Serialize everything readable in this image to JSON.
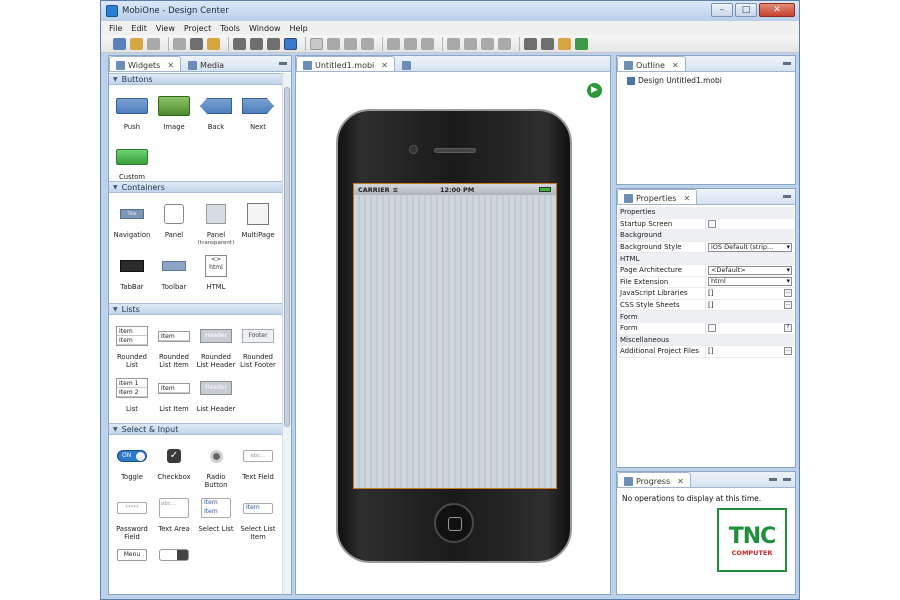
{
  "window": {
    "title": "MobiOne - Design Center",
    "minimize": "–",
    "maximize": "□",
    "close": "✕"
  },
  "menu": [
    "File",
    "Edit",
    "View",
    "Project",
    "Tools",
    "Window",
    "Help"
  ],
  "left_tabs": {
    "widgets": "Widgets",
    "media": "Media"
  },
  "sections": {
    "buttons": {
      "title": "Buttons",
      "items": [
        "Push",
        "Image",
        "Back",
        "Next",
        "Custom"
      ]
    },
    "containers": {
      "title": "Containers",
      "items": [
        "Navigation",
        "Panel",
        "Panel",
        "(transparent)",
        "MultiPage",
        "TabBar",
        "Toolbar",
        "HTML"
      ]
    },
    "lists": {
      "title": "Lists",
      "items": [
        "Rounded List",
        "Rounded List Item",
        "Rounded List Header",
        "Rounded List Footer",
        "List",
        "List Item",
        "List Header"
      ]
    },
    "select_input": {
      "title": "Select & Input",
      "items": [
        "Toggle",
        "Checkbox",
        "Radio Button",
        "Text Field",
        "Password Field",
        "Text Area",
        "Select List",
        "Select List Item"
      ]
    }
  },
  "widget_glyphs": {
    "nav_title": "Title",
    "html_tag": "<>",
    "html_word": "html",
    "item": "Item",
    "item1": "Item 1",
    "item2": "Item 2",
    "header": "Header",
    "footer": "Footer",
    "toggle_on": "ON",
    "check": "✓",
    "abc": "abc...",
    "password": "*****",
    "menu": "Menu"
  },
  "editor": {
    "tab": "Untitled1.mobi",
    "status": {
      "carrier": "CARRIER",
      "time": "12:00 PM"
    }
  },
  "outline": {
    "tab": "Outline",
    "item": "Design Untitled1.mobi"
  },
  "properties": {
    "tab": "Properties",
    "rows": [
      {
        "cat": "Properties"
      },
      {
        "k": "Startup Screen",
        "type": "check"
      },
      {
        "cat": "Background"
      },
      {
        "k": "Background Style",
        "type": "dd",
        "v": "iOS Default (strip..."
      },
      {
        "cat": "HTML"
      },
      {
        "k": "Page Architecture",
        "type": "dd",
        "v": "<Default>"
      },
      {
        "k": "File Extension",
        "type": "dd",
        "v": "html"
      },
      {
        "k": "JavaScript Libraries",
        "type": "list",
        "v": "[]"
      },
      {
        "k": "CSS Style Sheets",
        "type": "list",
        "v": "[]"
      },
      {
        "cat": "Form"
      },
      {
        "k": "Form",
        "type": "checkq"
      },
      {
        "cat": "Miscellaneous"
      },
      {
        "k": "Additional Project Files",
        "type": "list",
        "v": "[]"
      }
    ]
  },
  "progress": {
    "tab": "Progress",
    "message": "No operations to display at this time."
  },
  "logo": {
    "mark": "TNC",
    "sub": "COMPUTER"
  },
  "colors": {
    "accent": "#2c78c9",
    "window_frame": "#bcd2ea",
    "logo_green": "#1e8f3a"
  }
}
